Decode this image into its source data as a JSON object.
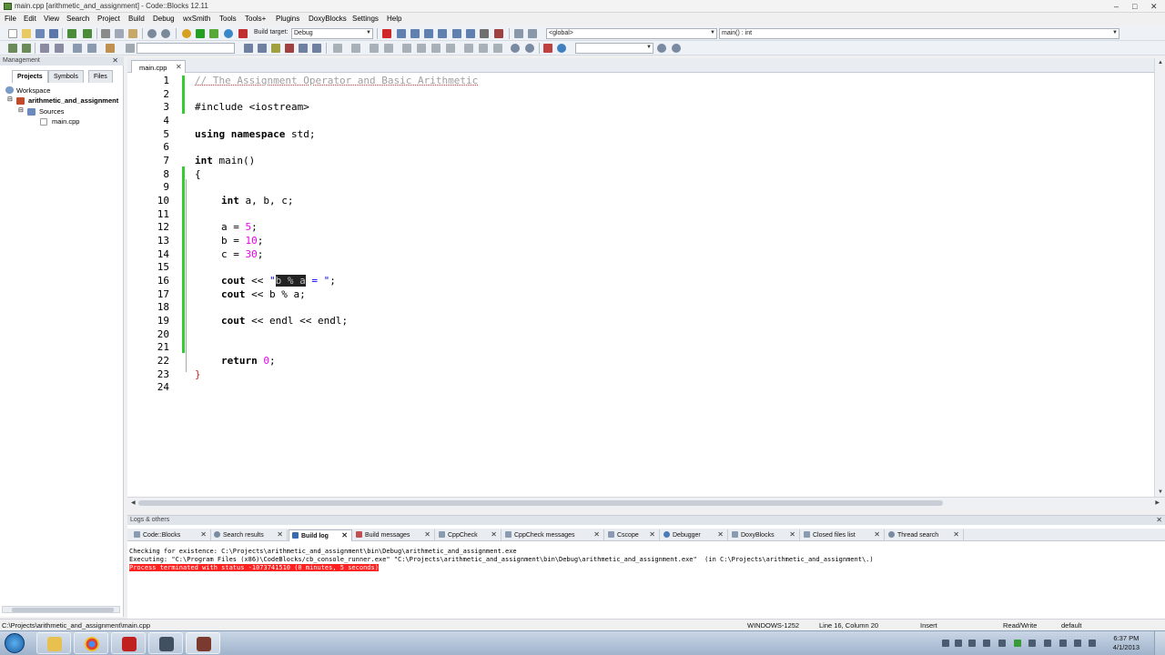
{
  "window": {
    "title": "main.cpp [arithmetic_and_assignment] - Code::Blocks 12.11",
    "min": "–",
    "max": "□",
    "close": "✕"
  },
  "menu": [
    "File",
    "Edit",
    "View",
    "Search",
    "Project",
    "Build",
    "Debug",
    "wxSmith",
    "Tools",
    "Tools+",
    "Plugins",
    "DoxyBlocks",
    "Settings",
    "Help"
  ],
  "toolbar": {
    "build_target_label": "Build target:",
    "build_target_value": "Debug",
    "scope_value": "<global>",
    "function_value": "main() : int",
    "search_value": ""
  },
  "management": {
    "header": "Management",
    "close": "✕",
    "tabs": [
      "Projects",
      "Symbols",
      "Files"
    ],
    "tree": {
      "workspace": "Workspace",
      "project": "arithmetic_and_assignment",
      "folder": "Sources",
      "file": "main.cpp"
    }
  },
  "editor": {
    "tab_label": "main.cpp",
    "tab_close": "✕",
    "line_numbers": [
      "1",
      "2",
      "3",
      "4",
      "5",
      "6",
      "7",
      "8",
      "9",
      "10",
      "11",
      "12",
      "13",
      "14",
      "15",
      "16",
      "17",
      "18",
      "19",
      "20",
      "21",
      "22",
      "23",
      "24"
    ],
    "code": {
      "l1": "// The Assignment Operator and Basic Arithmetic",
      "l3": "#include <iostream>",
      "l5_kw": "using namespace",
      "l5_rest": " std;",
      "l7_kw": "int",
      "l7_rest": " main()",
      "l8": "{",
      "l10_kw": "int",
      "l10_rest": " a, b, c;",
      "l12_a": "a = ",
      "l12_n": "5",
      "l12_e": ";",
      "l13_a": "b = ",
      "l13_n": "10",
      "l13_e": ";",
      "l14_a": "c = ",
      "l14_n": "30",
      "l14_e": ";",
      "l16_kw": "cout",
      "l16_op": " << ",
      "l16_q": "\"",
      "l16_sel": "b % a",
      "l16_after": " = ",
      "l16_q2": "\"",
      "l16_end": ";",
      "l17_kw": "cout",
      "l17_rest": " << b % a;",
      "l19_kw": "cout",
      "l19_rest": " << endl << endl;",
      "l22_kw": "return",
      "l22_sp": " ",
      "l22_n": "0",
      "l22_e": ";",
      "l23": "}"
    }
  },
  "logs": {
    "header": "Logs & others",
    "close": "✕",
    "tabs": [
      "Code::Blocks",
      "Search results",
      "Build log",
      "Build messages",
      "CppCheck",
      "CppCheck messages",
      "Cscope",
      "Debugger",
      "DoxyBlocks",
      "Closed files list",
      "Thread search"
    ],
    "active_tab": "Build log",
    "lines": [
      "Checking for existence: C:\\Projects\\arithmetic_and_assignment\\bin\\Debug\\arithmetic_and_assignment.exe",
      "Executing: \"C:\\Program Files (x86)\\CodeBlocks/cb_console_runner.exe\" \"C:\\Projects\\arithmetic_and_assignment\\bin\\Debug\\arithmetic_and_assignment.exe\"  (in C:\\Projects\\arithmetic_and_assignment\\.)",
      "Process terminated with status -1073741510 (0 minutes, 5 seconds)"
    ]
  },
  "status": {
    "path": "C:\\Projects\\arithmetic_and_assignment\\main.cpp",
    "encoding": "WINDOWS-1252",
    "position": "Line 16, Column 20",
    "mode": "Insert",
    "access": "Read/Write",
    "lang": "default"
  },
  "taskbar": {
    "time": "6:37 PM",
    "date": "4/1/2013"
  },
  "colors": {
    "error": "#ff2020",
    "changebar": "#33cc33",
    "number": "#f000f0",
    "string": "#0000ff",
    "comment": "#a0a0a0"
  }
}
